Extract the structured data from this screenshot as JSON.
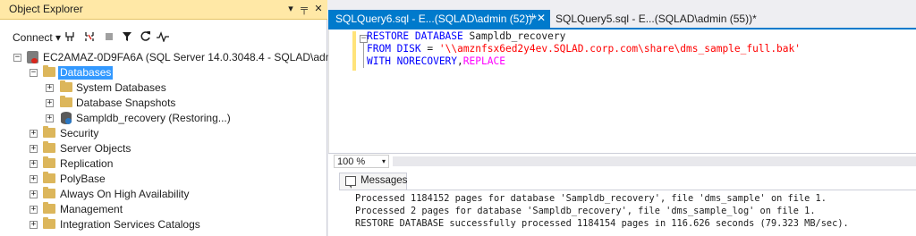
{
  "object_explorer": {
    "title": "Object Explorer",
    "title_buttons": {
      "dropdown": "▾",
      "pin": "╤",
      "close": "✕"
    },
    "toolbar": {
      "connect_label": "Connect",
      "icons": [
        "connect-icon",
        "disconnect-icon",
        "stop-icon",
        "filter-icon",
        "refresh-icon",
        "activity-monitor-icon"
      ]
    },
    "tree": {
      "server": "EC2AMAZ-0D9FA6A (SQL Server 14.0.3048.4 - SQLAD\\admin)",
      "databases": "Databases",
      "system_databases": "System Databases",
      "database_snapshots": "Database Snapshots",
      "sampldb": "Sampldb_recovery (Restoring...)",
      "security": "Security",
      "server_objects": "Server Objects",
      "replication": "Replication",
      "polybase": "PolyBase",
      "always_on": "Always On High Availability",
      "management": "Management",
      "integration_services": "Integration Services Catalogs"
    }
  },
  "tabs": {
    "active": "SQLQuery6.sql - E...(SQLAD\\admin (52))*",
    "active_pin": "⊣",
    "active_close": "✕",
    "inactive": "SQLQuery5.sql - E...(SQLAD\\admin (55))*"
  },
  "editor": {
    "line1": {
      "kw": "RESTORE DATABASE",
      "name": "Sampldb_recovery"
    },
    "line2": {
      "kw": "FROM DISK",
      "op": "=",
      "str": "'\\\\amznfsx6ed2y4ev.SQLAD.corp.com\\share\\dms_sample_full.bak'"
    },
    "line3": {
      "kw": "WITH NORECOVERY",
      "comma": ",",
      "fn": "REPLACE"
    }
  },
  "zoom": {
    "value": "100 %",
    "arrow": "▾"
  },
  "messages": {
    "tab_label": "Messages",
    "lines": [
      "Processed 1184152 pages for database 'Sampldb_recovery', file 'dms_sample' on file 1.",
      "Processed 2 pages for database 'Sampldb_recovery', file 'dms_sample_log' on file 1.",
      "RESTORE DATABASE successfully processed 1184154 pages in 116.626 seconds (79.323 MB/sec)."
    ]
  },
  "colors": {
    "accent": "#007acc",
    "title_bar": "#ffe8a6",
    "selection": "#3399ff",
    "keyword": "#0000ff",
    "string": "#ff0000",
    "function": "#ff00ff"
  }
}
